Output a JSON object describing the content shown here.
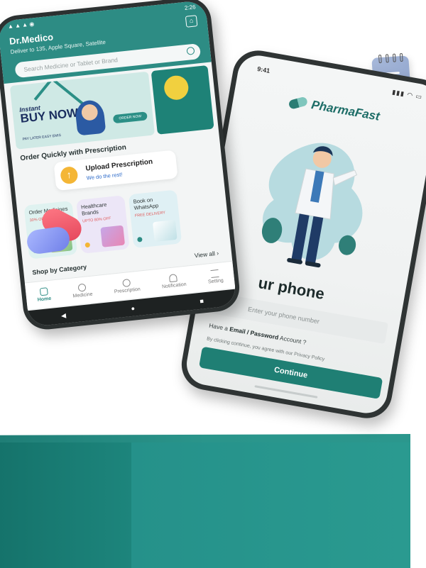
{
  "colors": {
    "brand": "#2d8c84",
    "accent_yellow": "#f4b636",
    "podium": "#1f857c"
  },
  "pharmafast": {
    "time": "9:41",
    "brand": "PharmaFast",
    "heading": "ur phone",
    "phone_placeholder": "Enter your phone number",
    "alt_prefix": "Have a",
    "alt_bold": "Email / Password",
    "alt_suffix": "Account ?",
    "terms": "By clicking continue, you agree with our Privacy Policy",
    "continue_label": "Continue"
  },
  "drmedico": {
    "time": "2:26",
    "title": "Dr.Medico",
    "deliver_to": "Deliver to 135, Apple Square, Satellite",
    "search_placeholder": "Search Medicine or Tablet or Brand",
    "banner": {
      "instant": "Instant",
      "buy_now": "BUY NOW",
      "pay_later": "PAY LATER EASY EMIS",
      "order_now": "ORDER NOW"
    },
    "section_title": "Order Quickly with Prescription",
    "upload_title": "Upload Prescription",
    "upload_sub": "We do the rest!",
    "cards": [
      {
        "title": "Order Medicines",
        "sub": "30% OFF"
      },
      {
        "title": "Healthcare Brands",
        "sub": "UPTO 80% OFF"
      },
      {
        "title": "Book on WhatsApp",
        "sub": "FREE DELIVERY"
      }
    ],
    "shop_title": "Shop by Category",
    "view_all": "View all",
    "nav": [
      "Home",
      "Medicine",
      "Prescription",
      "Notification",
      "Setting"
    ]
  }
}
